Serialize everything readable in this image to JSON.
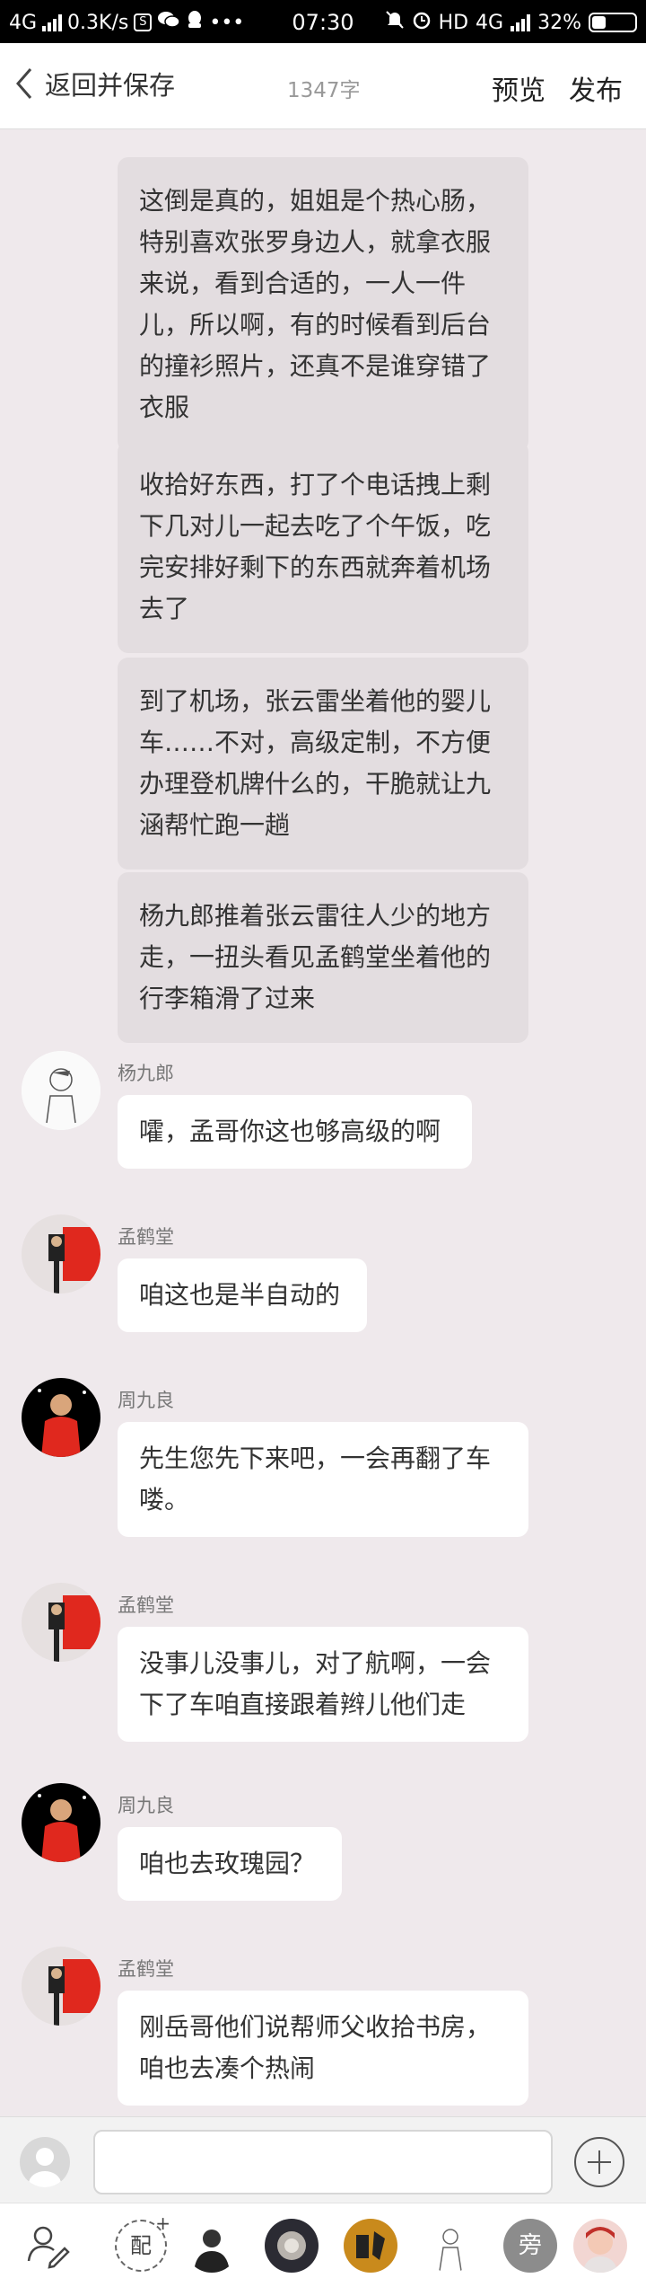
{
  "status_bar": {
    "network": "4G",
    "speed": "0.3K/s",
    "time": "07:30",
    "hd": "HD",
    "network2": "4G",
    "battery": "32%"
  },
  "header": {
    "back_label": "返回并保存",
    "word_count": "1347字",
    "preview_label": "预览",
    "publish_label": "发布"
  },
  "narrations": [
    "这倒是真的，姐姐是个热心肠，特别喜欢张罗身边人，就拿衣服来说，看到合适的，一人一件儿，所以啊，有的时候看到后台的撞衫照片，还真不是谁穿错了衣服",
    "收拾好东西，打了个电话拽上剩下几对儿一起去吃了个午饭，吃完安排好剩下的东西就奔着机场去了",
    "到了机场，张云雷坐着他的婴儿车……不对，高级定制，不方便办理登机牌什么的，干脆就让九涵帮忙跑一趟",
    "杨九郎推着张云雷往人少的地方走，一扭头看见孟鹤堂坐着他的行李箱滑了过来"
  ],
  "messages": [
    {
      "name": "杨九郎",
      "text": "嚯，孟哥你这也够高级的啊",
      "avatar": "sketch"
    },
    {
      "name": "孟鹤堂",
      "text": "咱这也是半自动的",
      "avatar": "meng"
    },
    {
      "name": "周九良",
      "text": "先生您先下来吧，一会再翻了车喽。",
      "avatar": "zhou"
    },
    {
      "name": "孟鹤堂",
      "text": "没事儿没事儿，对了航啊，一会下了车咱直接跟着辫儿他们走",
      "avatar": "meng"
    },
    {
      "name": "周九良",
      "text": "咱也去玫瑰园？",
      "avatar": "zhou"
    },
    {
      "name": "孟鹤堂",
      "text": "刚岳哥他们说帮师父收拾书房，咱也去凑个热闹",
      "avatar": "meng"
    }
  ],
  "input": {
    "placeholder": ""
  },
  "character_bar": {
    "peiyin_label": "配",
    "peiyin_plus": "+",
    "pang_label": "旁"
  },
  "colors": {
    "background": "#efe9ec",
    "narration_bubble": "#e3dde0",
    "dialog_bubble": "#ffffff",
    "avatar_red": "#e0281e"
  }
}
